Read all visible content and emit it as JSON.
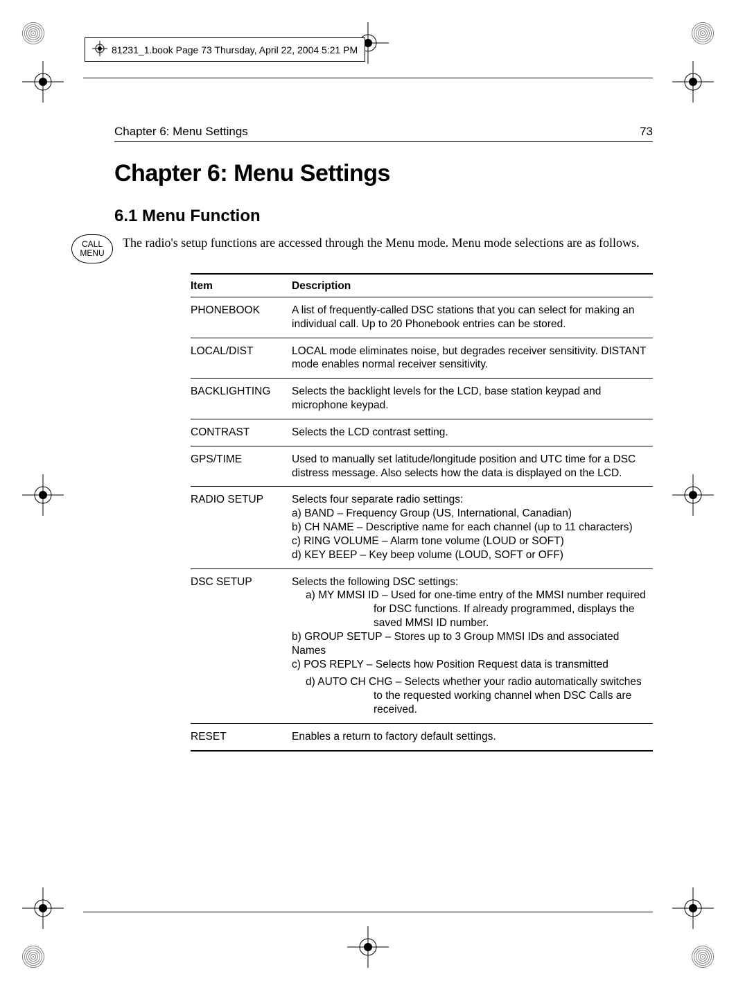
{
  "pageinfo": "81231_1.book  Page 73  Thursday, April 22, 2004  5:21 PM",
  "running_head": {
    "left": "Chapter 6: Menu Settings",
    "page": "73"
  },
  "chapter_title": "Chapter 6:  Menu Settings",
  "section_title": "6.1   Menu Function",
  "call_menu": {
    "line1": "CALL",
    "line2": "MENU"
  },
  "intro": "The radio's setup functions are accessed through the Menu mode. Menu mode selections are as follows.",
  "table": {
    "headers": {
      "item": "Item",
      "desc": "Description"
    },
    "rows": [
      {
        "item": "PHONEBOOK",
        "desc": "A list of frequently-called DSC stations that you can select for making an individual call. Up to 20 Phonebook entries can be stored."
      },
      {
        "item": "LOCAL/DIST",
        "desc": "LOCAL mode eliminates noise, but degrades receiver sensitivity. DISTANT mode enables normal receiver sensitivity."
      },
      {
        "item": "BACKLIGHTING",
        "desc": "Selects the backlight levels for the LCD, base station keypad and microphone keypad."
      },
      {
        "item": "CONTRAST",
        "desc": "Selects the LCD contrast setting."
      },
      {
        "item": "GPS/TIME",
        "desc": "Used to manually set latitude/longitude position and UTC time for a DSC distress message. Also selects how the data is displayed on the LCD."
      },
      {
        "item": "RADIO SETUP",
        "desc_intro": " Selects four separate radio settings:",
        "desc_lines": [
          "a) BAND – Frequency Group (US, International, Canadian)",
          "b) CH NAME – Descriptive name for each channel (up to 11 characters)",
          "c) RING VOLUME – Alarm tone volume (LOUD or SOFT)",
          "d) KEY BEEP – Key beep volume (LOUD, SOFT or OFF)"
        ]
      },
      {
        "item": "DSC SETUP",
        "desc_intro": " Selects the following DSC settings:",
        "dsc_a": "a) MY MMSI ID – Used for one-time entry of the MMSI number required for DSC functions. If already programmed, displays the saved MMSI ID number.",
        "dsc_b": "b) GROUP SETUP – Stores up to 3 Group MMSI IDs and associated Names",
        "dsc_c": "c) POS REPLY – Selects how Position Request data is transmitted",
        "dsc_d": "d) AUTO CH CHG – Selects whether your radio automatically switches to the requested working channel when DSC Calls are received."
      },
      {
        "item": "RESET",
        "desc": "Enables a return to factory default settings."
      }
    ]
  }
}
